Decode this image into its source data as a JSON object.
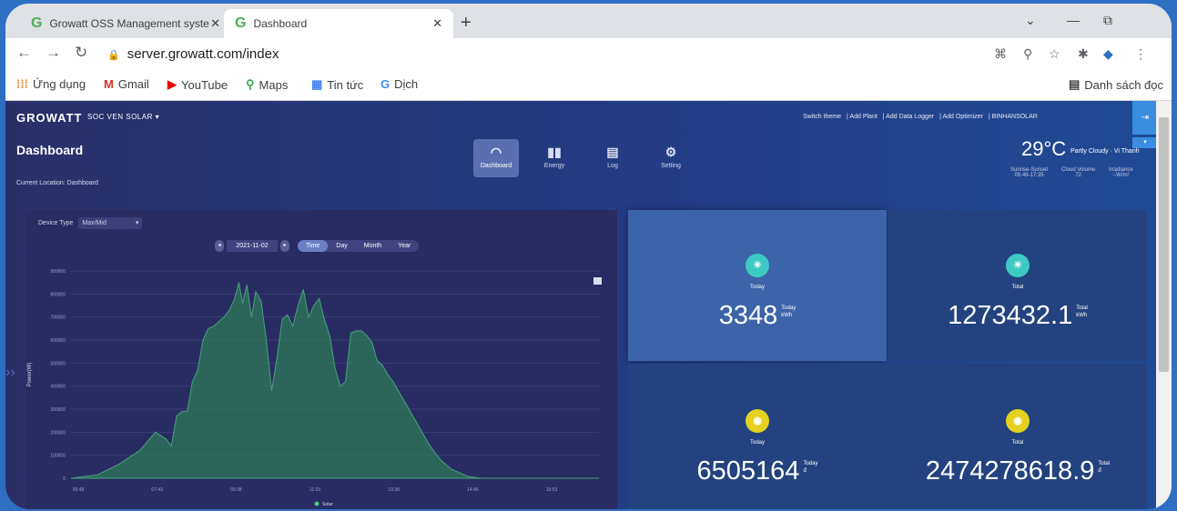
{
  "browser": {
    "tabs": [
      {
        "title": "Growatt OSS Management syste",
        "close": "✕"
      },
      {
        "title": "Dashboard",
        "close": "✕"
      }
    ],
    "new_tab": "+",
    "url": "server.growatt.com/index",
    "bookmarks": [
      {
        "label": "Ứng dụng",
        "icon": "apps-icon"
      },
      {
        "label": "Gmail",
        "icon": "gmail-icon"
      },
      {
        "label": "YouTube",
        "icon": "youtube-icon"
      },
      {
        "label": "Maps",
        "icon": "maps-icon"
      },
      {
        "label": "Tin tức",
        "icon": "news-icon"
      },
      {
        "label": "Dịch",
        "icon": "translate-icon"
      }
    ],
    "reading_list": "Danh sách đọc"
  },
  "app": {
    "logo": "GROWATT",
    "plant": "SOC VEN SOLAR ▾",
    "topnav": [
      "Switch theme",
      "Add Plant",
      "Add Data Logger",
      "Add Optimizer",
      "BINHANSOLAR"
    ],
    "page_title": "Dashboard",
    "location": "Current Location: Dashboard",
    "main_nav": [
      {
        "label": "Dashboard",
        "icon": "gauge-icon"
      },
      {
        "label": "Energy",
        "icon": "bar-chart-icon"
      },
      {
        "label": "Log",
        "icon": "log-icon"
      },
      {
        "label": "Setting",
        "icon": "gear-icon"
      }
    ],
    "weather": {
      "temp": "29°C",
      "desc": "Partly Cloudy · Vi Thanh",
      "sunrise_label": "Sunrise-Sunset",
      "sunrise_value": "05:49-17:35",
      "cloud_label": "Cloud Volume",
      "cloud_value": "72",
      "irr_label": "Irradiance",
      "irr_value": "--W/m²"
    }
  },
  "chart_panel": {
    "device_type_label": "Device Type",
    "device_type_value": "Max/Mid",
    "date": "2021-11-02",
    "periods": [
      "Time",
      "Day",
      "Month",
      "Year"
    ],
    "legend": "Solar"
  },
  "cards": [
    {
      "caption": "Today",
      "value": "3348",
      "unit_top": "Today",
      "unit_bottom": "kWh"
    },
    {
      "caption": "Total",
      "value": "1273432.1",
      "unit_top": "Total",
      "unit_bottom": "kWh"
    },
    {
      "caption": "Today",
      "value": "6505164",
      "unit_top": "Today",
      "unit_bottom": "đ"
    },
    {
      "caption": "Total",
      "value": "2474278618.9",
      "unit_top": "Total",
      "unit_bottom": "đ"
    }
  ],
  "colors": {
    "teal": "#3ec9c5",
    "yellow": "#e5d11f",
    "accent": "#3a8de0",
    "series": "#2e7a5a"
  },
  "chart_data": {
    "type": "area",
    "title": "",
    "xlabel": "",
    "ylabel": "Power(W)",
    "x_ticks": [
      "05:48",
      "07:43",
      "09:38",
      "11:33",
      "13:38",
      "14:46",
      "16:53"
    ],
    "y_ticks": [
      "0",
      "100000",
      "200000",
      "300000",
      "400000",
      "500000",
      "600000",
      "700000",
      "800000",
      "900000"
    ],
    "ylim": [
      0,
      900000
    ],
    "xlim": [
      0,
      100
    ],
    "series": [
      {
        "name": "Solar",
        "x": [
          0,
          5,
          9,
          13,
          16,
          18,
          19,
          20,
          21,
          22,
          23,
          24,
          25,
          26,
          27,
          28,
          29,
          30,
          31,
          31.8,
          32.5,
          33.3,
          34.2,
          35,
          36,
          37,
          38,
          39,
          40,
          41,
          42,
          43,
          44,
          45,
          46,
          47,
          48,
          49,
          50,
          51,
          52,
          53,
          54,
          55,
          56,
          57,
          58,
          59,
          60,
          61,
          62,
          63,
          64,
          65,
          66,
          67,
          68,
          69,
          70,
          71,
          72,
          73,
          74,
          75,
          76,
          77,
          78,
          79,
          80,
          81,
          82,
          83,
          84,
          85,
          86,
          87,
          88,
          89,
          90,
          92,
          94,
          96,
          100
        ],
        "y": [
          0,
          15000,
          60000,
          120000,
          200000,
          170000,
          140000,
          270000,
          290000,
          290000,
          420000,
          470000,
          600000,
          650000,
          660000,
          680000,
          700000,
          730000,
          780000,
          850000,
          760000,
          840000,
          700000,
          810000,
          770000,
          600000,
          380000,
          520000,
          690000,
          710000,
          660000,
          750000,
          820000,
          700000,
          750000,
          780000,
          690000,
          620000,
          480000,
          400000,
          420000,
          630000,
          640000,
          640000,
          620000,
          590000,
          510000,
          490000,
          450000,
          420000,
          380000,
          340000,
          300000,
          260000,
          220000,
          180000,
          140000,
          110000,
          80000,
          60000,
          40000,
          30000,
          20000,
          10000,
          5000,
          2000,
          0,
          0,
          0,
          0,
          0,
          0,
          0,
          0,
          0,
          0,
          0,
          0,
          0,
          0,
          0,
          0,
          0
        ]
      }
    ]
  }
}
